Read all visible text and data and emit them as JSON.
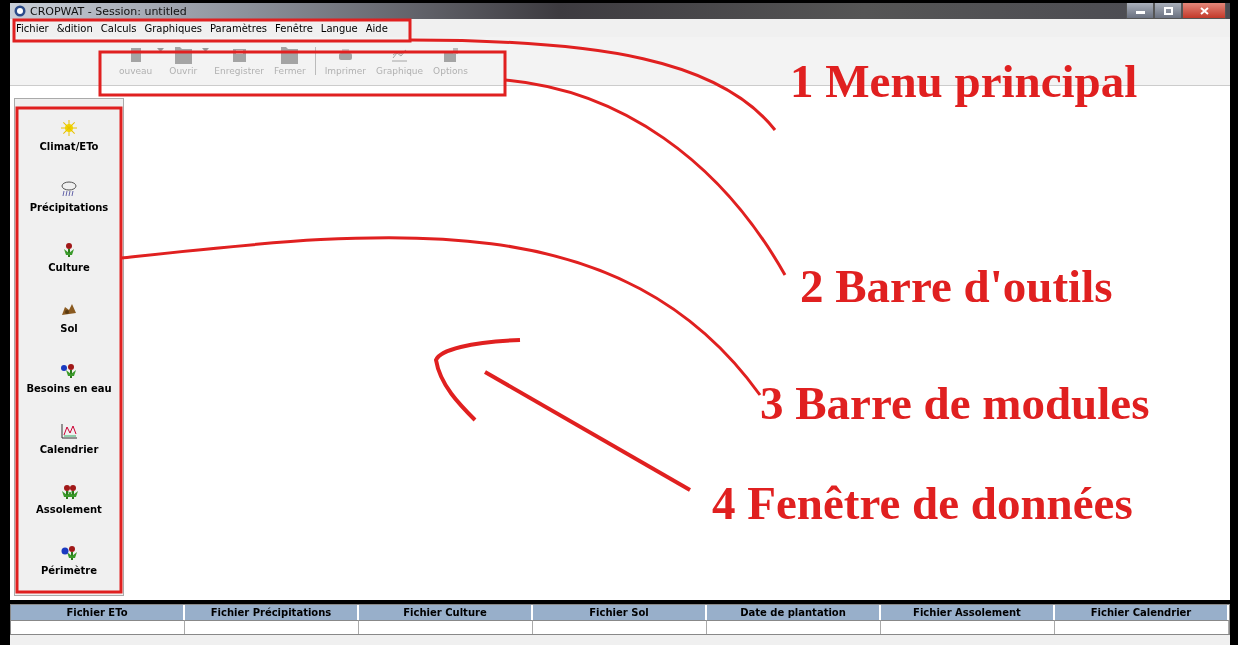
{
  "window": {
    "title": "CROPWAT - Session: untitled"
  },
  "menu": [
    "Fichier",
    "&dition",
    "Calculs",
    "Graphiques",
    "Paramètres",
    "Fenêtre",
    "Langue",
    "Aide"
  ],
  "toolbar": [
    {
      "label": "ouveau",
      "disabled": true,
      "dropdown": true,
      "kind": "new"
    },
    {
      "label": "Ouvrir",
      "disabled": true,
      "dropdown": true,
      "kind": "open"
    },
    {
      "label": "Enregistrer",
      "disabled": true,
      "dropdown": false,
      "kind": "save"
    },
    {
      "label": "Fermer",
      "disabled": true,
      "dropdown": false,
      "kind": "close"
    },
    {
      "label": "Imprimer",
      "disabled": true,
      "dropdown": false,
      "kind": "print"
    },
    {
      "label": "Graphique",
      "disabled": true,
      "dropdown": false,
      "kind": "chart"
    },
    {
      "label": "Options",
      "disabled": true,
      "dropdown": false,
      "kind": "options"
    }
  ],
  "modules": [
    {
      "label": "Climat/ETo",
      "kind": "sun"
    },
    {
      "label": "Précipitations",
      "kind": "rain"
    },
    {
      "label": "Culture",
      "kind": "plant"
    },
    {
      "label": "Sol",
      "kind": "soil"
    },
    {
      "label": "Besoins en eau",
      "kind": "water"
    },
    {
      "label": "Calendrier",
      "kind": "calendar"
    },
    {
      "label": "Assolement",
      "kind": "rotation"
    },
    {
      "label": "Périmètre",
      "kind": "scheme"
    }
  ],
  "status_table": {
    "columns": [
      "Fichier ETo",
      "Fichier Précipitations",
      "Fichier Culture",
      "Fichier Sol",
      "Date de plantation",
      "Fichier Assolement",
      "Fichier Calendrier"
    ]
  },
  "annotations": [
    "1 Menu principal",
    "2 Barre d'outils",
    "3 Barre de modules",
    "4 Fenêtre de données"
  ]
}
